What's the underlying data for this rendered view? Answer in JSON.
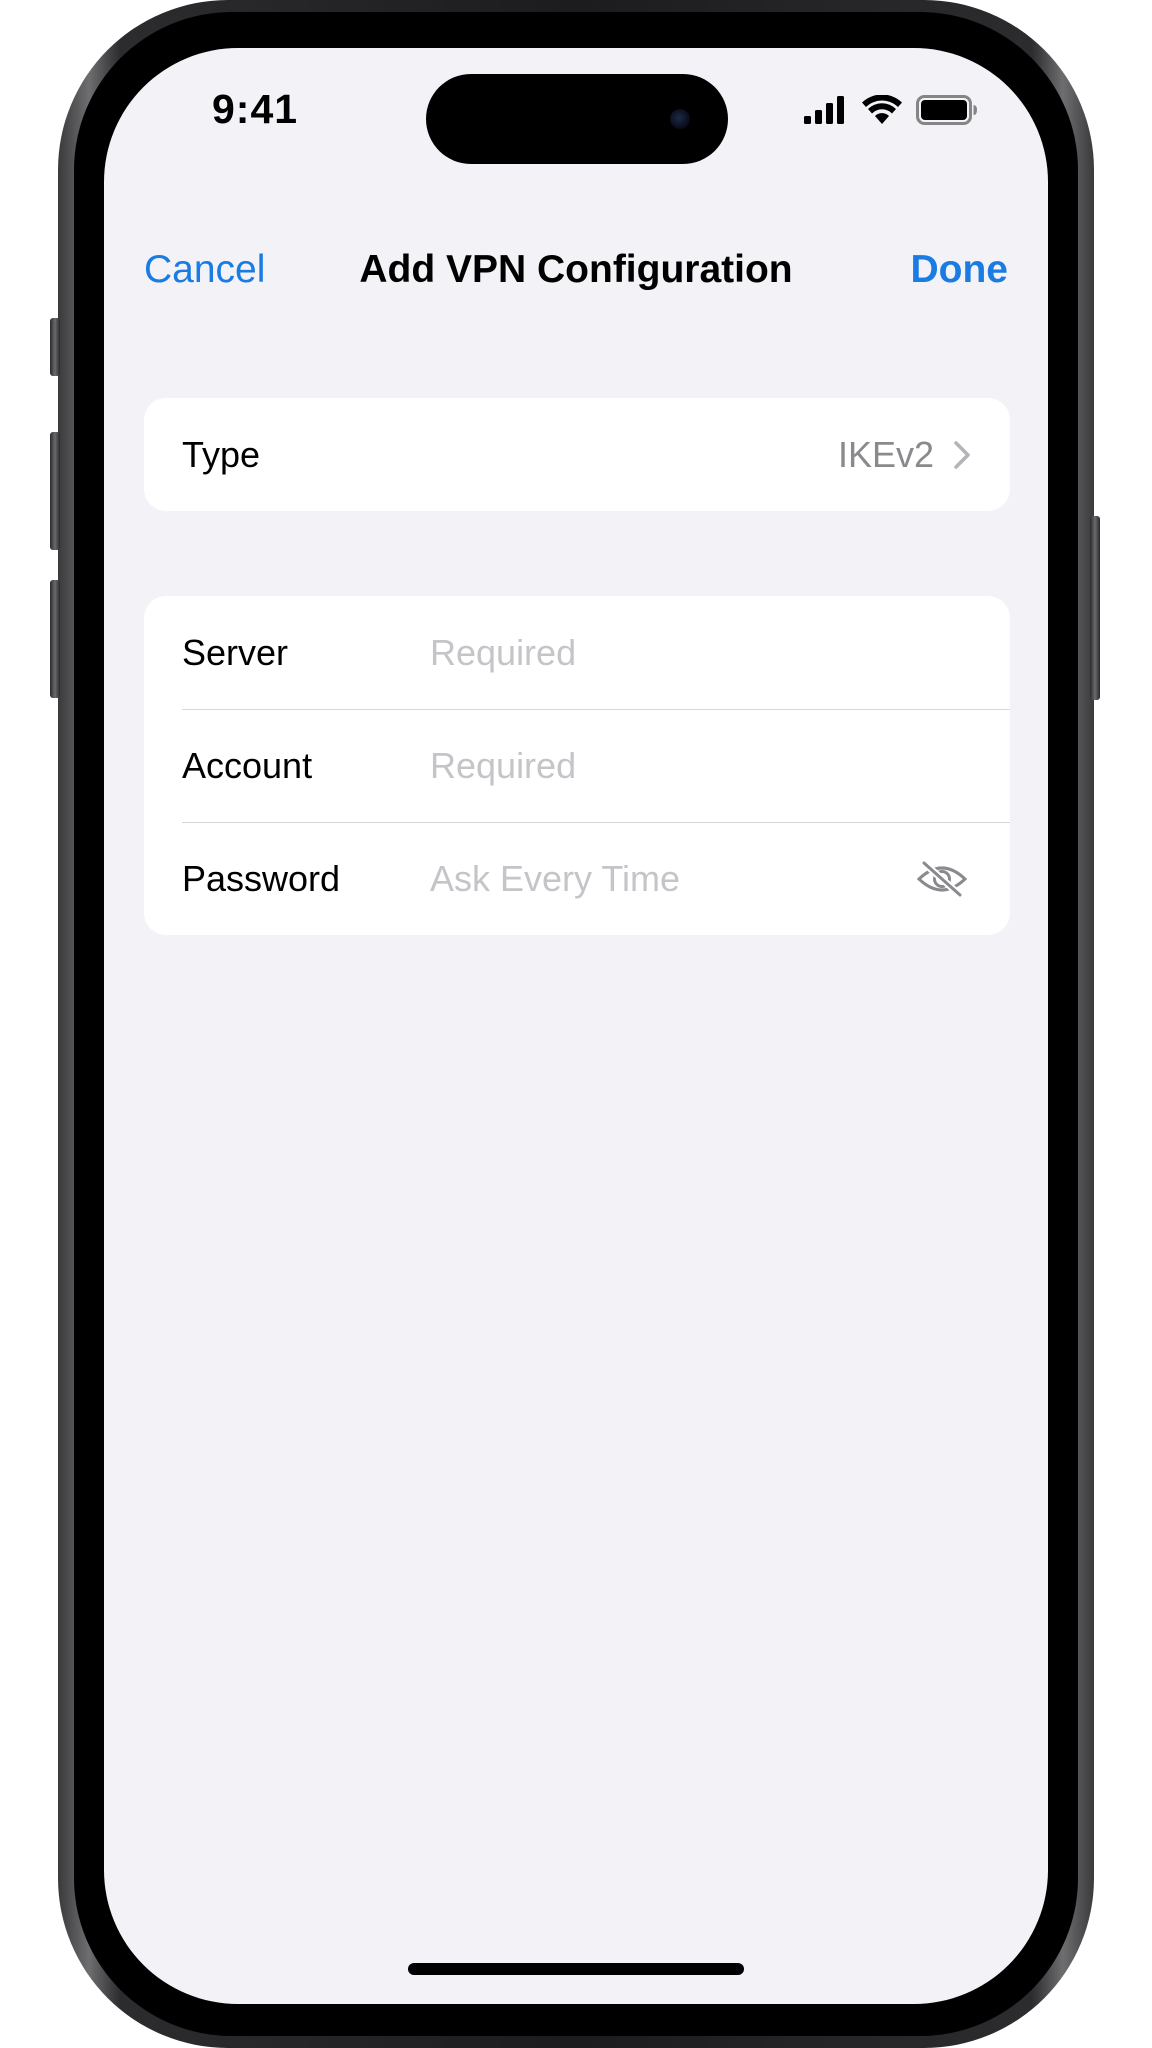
{
  "status_bar": {
    "time": "9:41",
    "icons": [
      "signal-icon",
      "wifi-icon",
      "battery-icon"
    ]
  },
  "nav": {
    "cancel_label": "Cancel",
    "title": "Add VPN Configuration",
    "done_label": "Done"
  },
  "type_row": {
    "label": "Type",
    "value": "IKEv2",
    "icon": "chevron-right-icon"
  },
  "form": {
    "server": {
      "label": "Server",
      "placeholder": "Required"
    },
    "account": {
      "label": "Account",
      "placeholder": "Required"
    },
    "password": {
      "label": "Password",
      "placeholder": "Ask Every Time",
      "icon": "eye-slash-icon"
    }
  },
  "colors": {
    "accent": "#1a7be3",
    "background": "#f2f2f7",
    "placeholder": "#c5c5c9",
    "secondary_text": "#8a8a8e"
  }
}
